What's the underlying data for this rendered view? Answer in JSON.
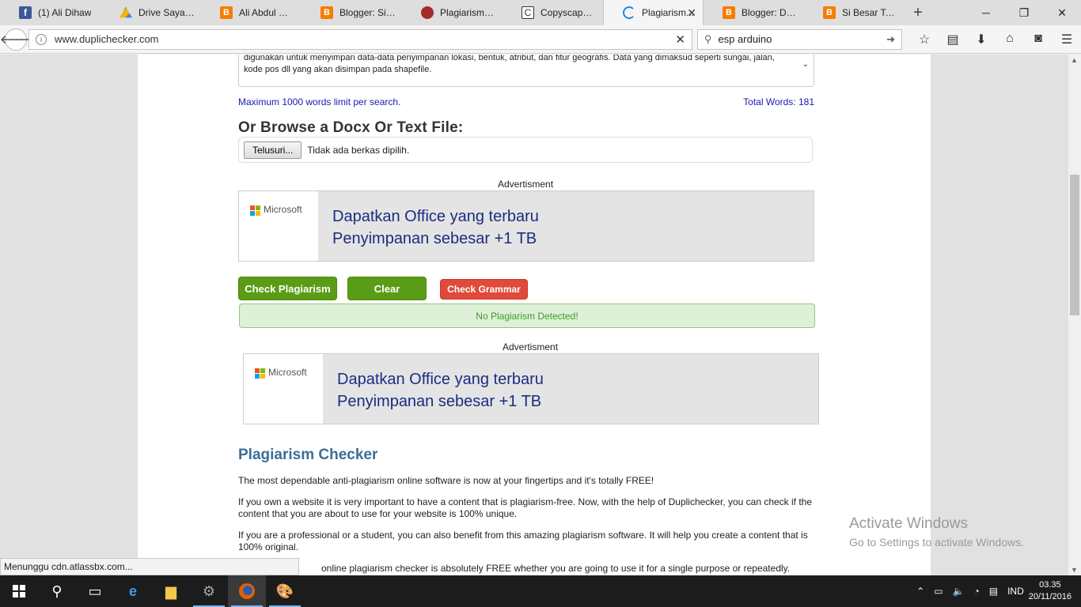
{
  "browser": {
    "tabs": [
      {
        "label": "(1) Ali Dihaw",
        "icon": "facebook-icon",
        "color": "#3b5998"
      },
      {
        "label": "Drive Saya - G...",
        "icon": "google-drive-icon",
        "color": "#f4b400"
      },
      {
        "label": "Ali Abdul Wah...",
        "icon": "blogger-icon",
        "color": "#f57d00"
      },
      {
        "label": "Blogger: Si Bes...",
        "icon": "blogger-icon",
        "color": "#f57d00"
      },
      {
        "label": "Plagiarisme - ...",
        "icon": "site-icon",
        "color": "#a52a2a"
      },
      {
        "label": "Copyscape se...",
        "icon": "copyscape-icon",
        "color": "#ffffff"
      },
      {
        "label": "Plagiarism...",
        "icon": "loading-icon",
        "color": "#1e88e5",
        "active": true
      },
      {
        "label": "Blogger: Dasb...",
        "icon": "blogger-icon",
        "color": "#f57d00"
      },
      {
        "label": "Si Besar Tapi K...",
        "icon": "blogger-icon",
        "color": "#f57d00"
      }
    ],
    "url": "www.duplichecker.com",
    "search_value": "esp arduino"
  },
  "page": {
    "textarea_text": "digunakan untuk menyimpan data-data penyimpanan lokasi, bentuk, atribut, dan fitur geografis. Data yang dimaksud  seperti sungai, jalan, kode pos dll yang akan disimpan pada shapefile.",
    "limit_note": "Maximum 1000 words limit per search.",
    "total_words": "Total Words: 181",
    "browse_heading": "Or Browse a Docx Or Text File:",
    "file_button": "Telusuri...",
    "file_status": "Tidak ada berkas dipilih.",
    "ad_label": "Advertisment",
    "ad_brand": "Microsoft",
    "ad_line1": "Dapatkan Office yang terbaru",
    "ad_line2": "Penyimpanan sebesar +1 TB",
    "check_button": "Check Plagiarism",
    "clear_button": "Clear",
    "grammar_button": "Check Grammar",
    "result": "No Plagiarism Detected!",
    "section_title": "Plagiarism Checker",
    "p1": "The most dependable anti-plagiarism online software is now at your fingertips and it's totally FREE!",
    "p2": "If you own a website it is very important to have a content that is plagiarism-free. Now, with the help of Duplichecker, you can check if the content that you are about to use for your website is 100% unique.",
    "p3": "If you are a professional or a student, you can also benefit from this amazing plagiarism software. It will help you create a content that is 100% original.",
    "p4": "online plagiarism checker is absolutely FREE whether you are going to use it for a single purpose or repeatedly."
  },
  "status_text": "Menunggu cdn.atlassbx.com...",
  "watermark": {
    "line1": "Activate Windows",
    "line2": "Go to Settings to activate Windows."
  },
  "taskbar": {
    "language": "IND",
    "time": "03.35",
    "date": "20/11/2016"
  }
}
